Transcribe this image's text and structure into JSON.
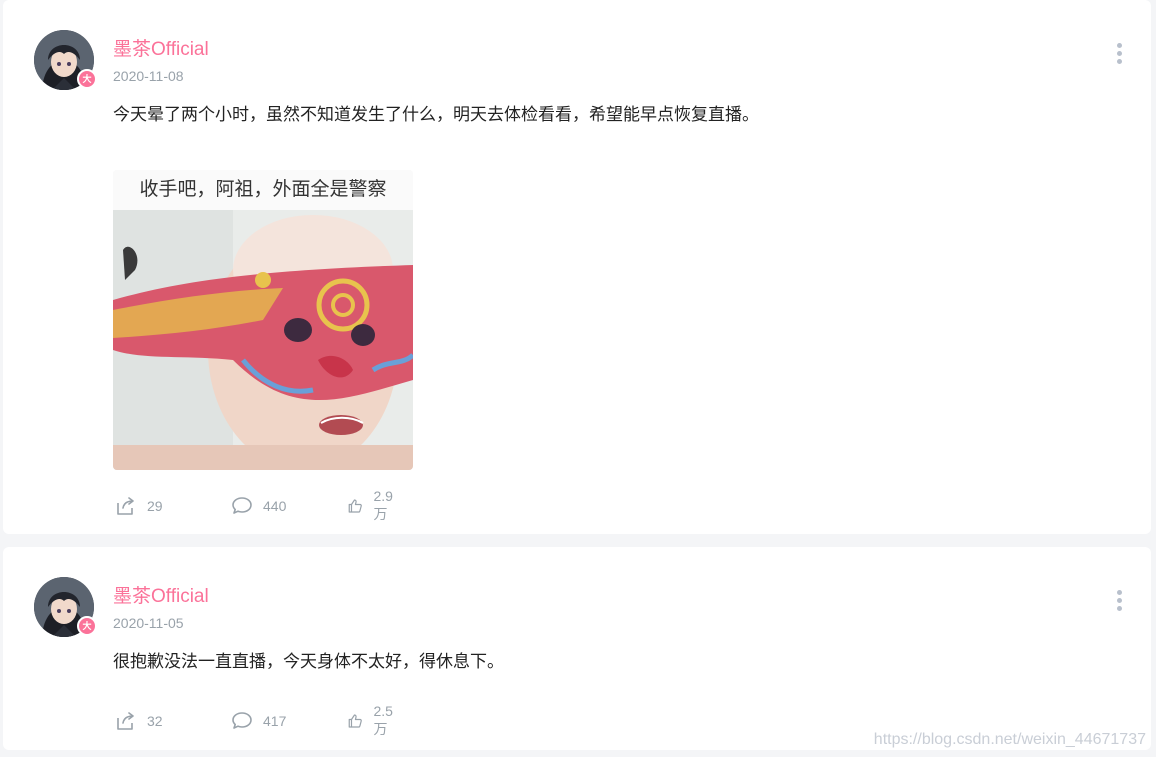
{
  "posts": [
    {
      "author": "墨茶Official",
      "date": "2020-11-08",
      "text": "今天晕了两个小时，虽然不知道发生了什么，明天去体检看看，希望能早点恢复直播。",
      "image_caption": "收手吧，阿祖，外面全是警察",
      "badge_icon": "up-badge-icon",
      "shares": "29",
      "comments": "440",
      "likes": "2.9万"
    },
    {
      "author": "墨茶Official",
      "date": "2020-11-05",
      "text": "很抱歉没法一直直播，今天身体不太好，得休息下。",
      "badge_icon": "up-badge-icon",
      "shares": "32",
      "comments": "417",
      "likes": "2.5万"
    }
  ],
  "watermark": "https://blog.csdn.net/weixin_44671737",
  "colors": {
    "author_name": "#fb7299",
    "meta_text": "#99a2aa",
    "background": "#f4f5f7"
  }
}
